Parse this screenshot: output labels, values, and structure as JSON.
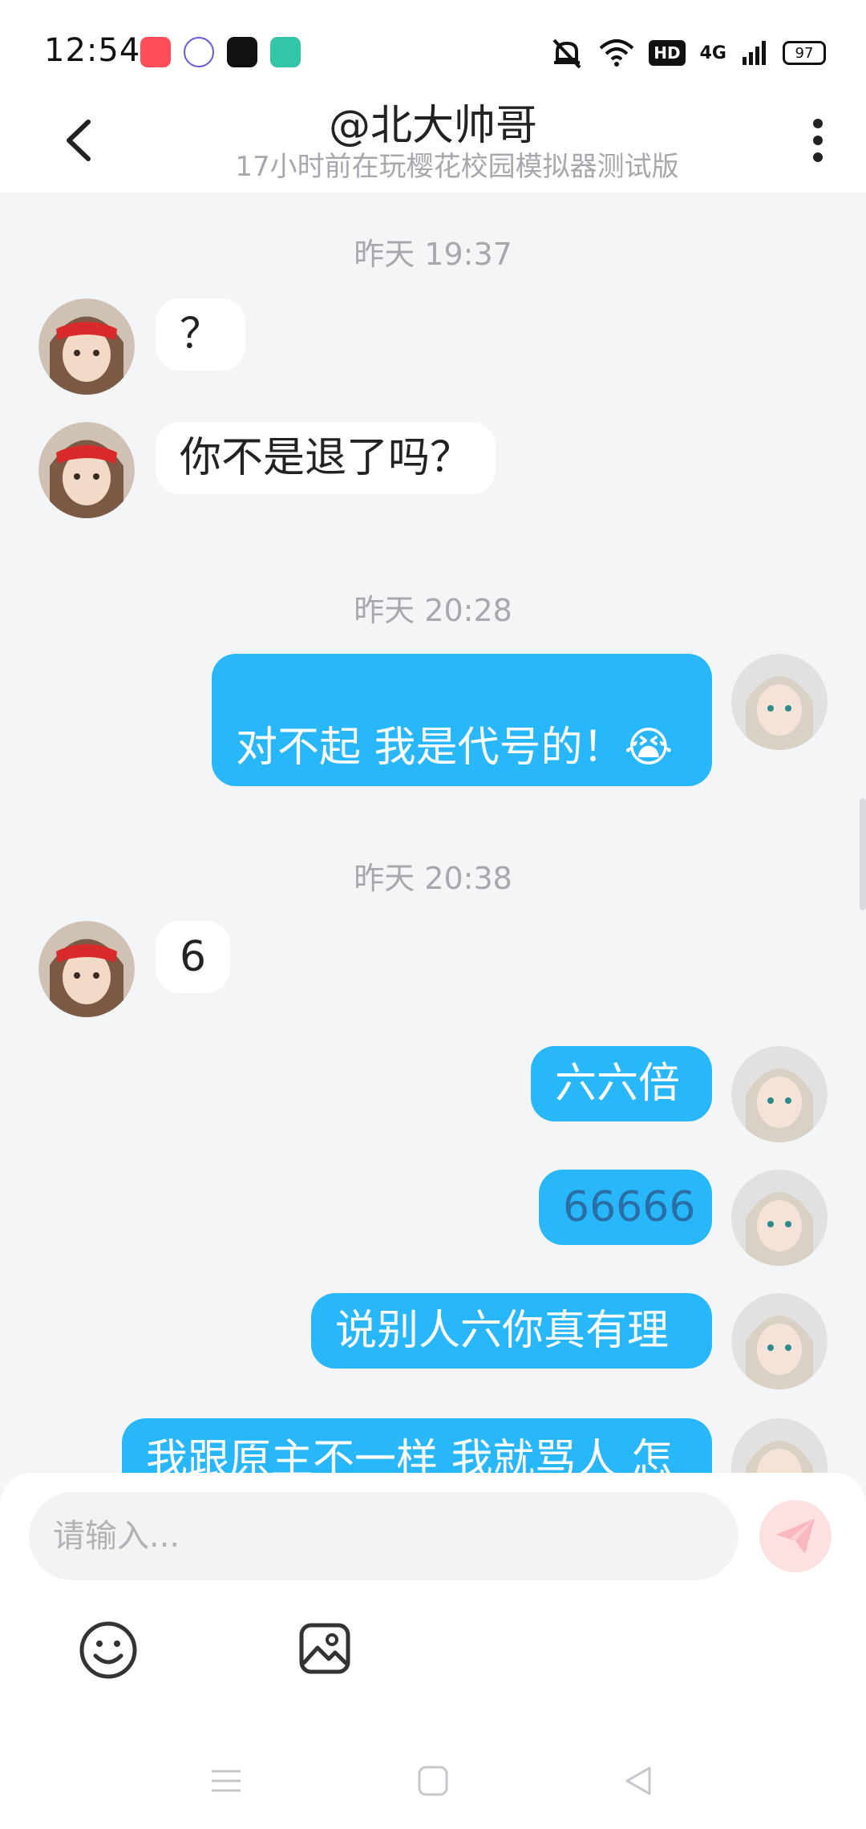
{
  "status_bar": {
    "time": "12:54",
    "battery": "97",
    "network": "4G",
    "hd_badge": "HD"
  },
  "header": {
    "title": "@北大帅哥",
    "subtitle": "17小时前在玩樱花校园模拟器测试版"
  },
  "messages": {
    "timestamps": [
      "昨天 19:37",
      "昨天 20:28",
      "昨天 20:38"
    ],
    "incoming": [
      "？",
      "你不是退了吗？",
      "6"
    ],
    "outgoing": [
      "对不起 我是代号的！😭",
      "六六倍",
      "66666",
      "说别人六你真有理",
      "我跟原主不一样 我就骂人 怎"
    ]
  },
  "input": {
    "placeholder": "请输入..."
  },
  "colors": {
    "accent_blue": "#29b7fb",
    "send_button_bg": "#fde0e2",
    "send_button_icon": "#f8b8bd",
    "timestamp_gray": "#a6a8ad"
  },
  "icons": {
    "back": "chevron-left-icon",
    "more": "more-vertical-icon",
    "send": "paper-plane-icon",
    "emoji": "smiley-icon",
    "image": "image-icon",
    "nav_menu": "menu-icon",
    "nav_home": "square-icon",
    "nav_back": "triangle-back-icon"
  }
}
